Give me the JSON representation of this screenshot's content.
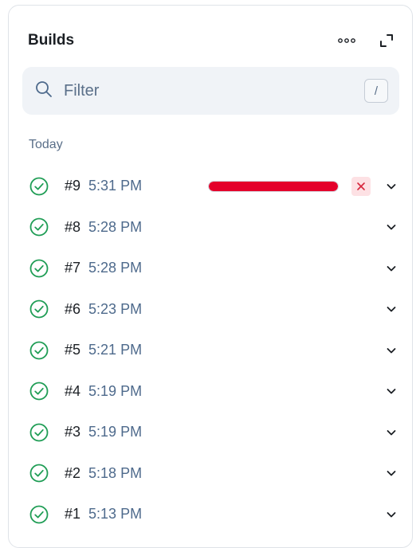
{
  "panel": {
    "title": "Builds"
  },
  "filter": {
    "placeholder": "Filter",
    "shortcut": "/"
  },
  "section": {
    "label": "Today"
  },
  "colors": {
    "success": "#1f9d55",
    "progress": "#e4002b",
    "muted": "#5a6f89"
  },
  "builds": [
    {
      "number": "#9",
      "time": "5:31 PM",
      "status": "running",
      "progress": 1.0
    },
    {
      "number": "#8",
      "time": "5:28 PM",
      "status": "success"
    },
    {
      "number": "#7",
      "time": "5:28 PM",
      "status": "success"
    },
    {
      "number": "#6",
      "time": "5:23 PM",
      "status": "success"
    },
    {
      "number": "#5",
      "time": "5:21 PM",
      "status": "success"
    },
    {
      "number": "#4",
      "time": "5:19 PM",
      "status": "success"
    },
    {
      "number": "#3",
      "time": "5:19 PM",
      "status": "success"
    },
    {
      "number": "#2",
      "time": "5:18 PM",
      "status": "success"
    },
    {
      "number": "#1",
      "time": "5:13 PM",
      "status": "success"
    }
  ]
}
